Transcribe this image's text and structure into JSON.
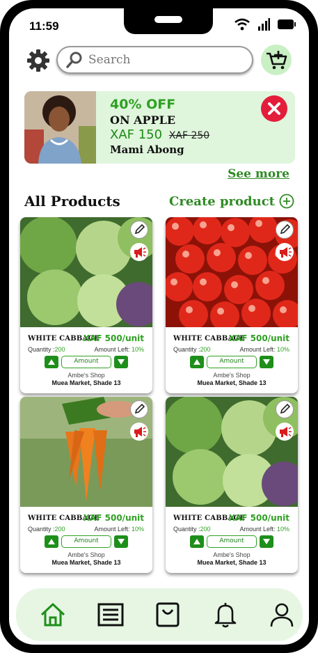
{
  "status_bar": {
    "time": "11:59"
  },
  "search": {
    "placeholder": "Search"
  },
  "promo": {
    "discount": "40% OFF",
    "item": "ON APPLE",
    "price": "XAF 150",
    "old_price": "XAF 250",
    "seller": "Mami Abong"
  },
  "see_more": "See more",
  "section": {
    "title": "All Products",
    "create_label": "Create product"
  },
  "products": [
    {
      "name": "WHITE CABBAGE",
      "price": "XAF 500/unit",
      "quantity_label": "Quantity :",
      "quantity": "200",
      "left_label": "Amount Left:",
      "left": "10%",
      "amount_label": "Amount",
      "shop": "Ambe's Shop",
      "market": "Muea Market, Shade 13",
      "image": "cabbage"
    },
    {
      "name": "WHITE CABBAGE",
      "price": "XAF 500/unit",
      "quantity_label": "Quantity :",
      "quantity": "200",
      "left_label": "Amount Left:",
      "left": "10%",
      "amount_label": "Amount",
      "shop": "Ambe's Shop",
      "market": "Muea Market, Shade 13",
      "image": "tomatoes"
    },
    {
      "name": "WHITE CABBAGE",
      "price": "XAF 500/unit",
      "quantity_label": "Quantity :",
      "quantity": "200",
      "left_label": "Amount Left:",
      "left": "10%",
      "amount_label": "Amount",
      "shop": "Ambe's Shop",
      "market": "Muea Market, Shade 13",
      "image": "carrots"
    },
    {
      "name": "WHITE CABBAGE",
      "price": "XAF 500/unit",
      "quantity_label": "Quantity :",
      "quantity": "200",
      "left_label": "Amount Left:",
      "left": "10%",
      "amount_label": "Amount",
      "shop": "Ambe's Shop",
      "market": "Muea Market, Shade 13",
      "image": "cabbage"
    }
  ],
  "nav": {
    "items": [
      "home-icon",
      "list-icon",
      "shopping-bag-icon",
      "bell-icon",
      "profile-icon"
    ],
    "active": "home-icon"
  },
  "colors": {
    "accent_green": "#2fa022",
    "dark_green": "#1e8f1a",
    "promo_bg": "#dff5dc",
    "nav_bg": "#e6f6e3",
    "close_red": "#e41d3a"
  }
}
